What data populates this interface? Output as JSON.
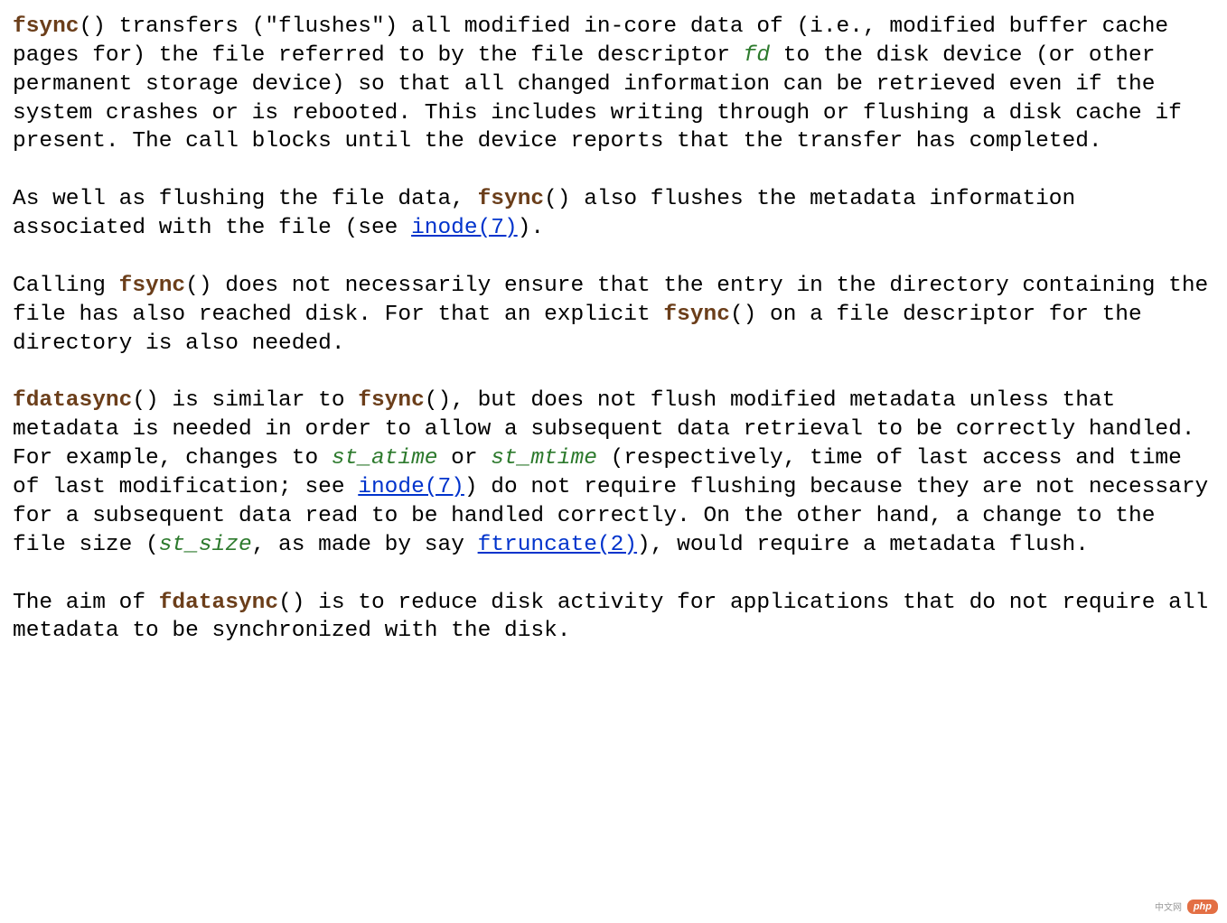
{
  "p1": {
    "t1": "fsync",
    "t2": "() transfers (\"flushes\") all modified in-core data of (i.e., modified buffer cache pages for) the file referred to by the file descriptor ",
    "t3": "fd",
    "t4": " to the disk device (or other permanent storage device) so that all changed information can be retrieved even if the system crashes or is rebooted.  This includes writing through or flushing a disk cache if present.  The call blocks until the device reports that the transfer has completed."
  },
  "p2": {
    "t1": "As well as flushing the file data, ",
    "t2": "fsync",
    "t3": "() also flushes the metadata information associated with the file (see ",
    "t4": "inode(7)",
    "t5": ")."
  },
  "p3": {
    "t1": "Calling ",
    "t2": "fsync",
    "t3": "() does not necessarily ensure that the entry in the directory containing the file has also reached disk.  For that an explicit ",
    "t4": "fsync",
    "t5": "() on a file descriptor for the directory is also needed."
  },
  "p4": {
    "t1": "fdatasync",
    "t2": "() is similar to ",
    "t3": "fsync",
    "t4": "(), but does not flush modified metadata unless that metadata is needed in order to allow a subsequent data retrieval to be correctly handled.  For example, changes to ",
    "t5": "st_atime",
    "t6": " or ",
    "t7": "st_mtime",
    "t8": " (respectively, time of last access and time of last modification; see ",
    "t9": "inode(7)",
    "t10": ") do not require flushing because they are not necessary for a subsequent data read to be handled correctly.  On the other hand, a change to the file size (",
    "t11": "st_size",
    "t12": ", as made by say ",
    "t13": "ftruncate(2)",
    "t14": "), would require a metadata flush."
  },
  "p5": {
    "t1": "The aim of ",
    "t2": "fdatasync",
    "t3": "() is to reduce disk activity for applications that do not require all metadata to be synchronized with the disk."
  },
  "watermark": "php",
  "watermark_cn": "中文网"
}
